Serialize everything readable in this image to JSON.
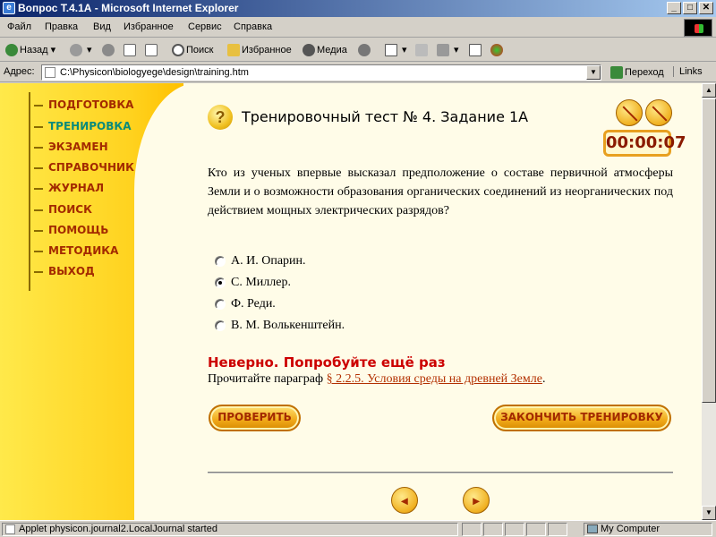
{
  "window": {
    "title": "Вопрос Т.4.1А - Microsoft Internet Explorer",
    "controls": [
      "_",
      "□",
      "✕"
    ]
  },
  "menu": [
    "Файл",
    "Правка",
    "Вид",
    "Избранное",
    "Сервис",
    "Справка"
  ],
  "toolbar": {
    "back": "Назад",
    "search": "Поиск",
    "favorites": "Избранное",
    "media": "Медиа"
  },
  "address": {
    "label": "Адрес:",
    "url": "C:\\Physicon\\biologyege\\design\\training.htm",
    "go": "Переход",
    "links": "Links"
  },
  "sidebar": {
    "items": [
      {
        "label": "ПОДГОТОВКА",
        "active": false
      },
      {
        "label": "ТРЕНИРОВКА",
        "active": true
      },
      {
        "label": "ЭКЗАМЕН",
        "active": false
      },
      {
        "label": "СПРАВОЧНИК",
        "active": false
      },
      {
        "label": "ЖУРНАЛ",
        "active": false
      },
      {
        "label": "ПОИСК",
        "active": false
      },
      {
        "label": "ПОМОЩЬ",
        "active": false
      },
      {
        "label": "МЕТОДИКА",
        "active": false
      },
      {
        "label": "ВЫХОД",
        "active": false
      }
    ]
  },
  "main": {
    "icon": "?",
    "title": "Тренировочный тест № 4. Задание 1А",
    "timer": "00:00:07",
    "question": "Кто из ученых впервые высказал предположение о составе первичной атмосферы Земли и о возможности образования органических соединений из неорганических под действием мощных электрических разрядов?",
    "options": [
      {
        "label": "А. И. Опарин.",
        "selected": false
      },
      {
        "label": "С. Миллер.",
        "selected": true
      },
      {
        "label": "Ф. Реди.",
        "selected": false
      },
      {
        "label": "В. М. Волькенштейн.",
        "selected": false
      }
    ],
    "feedback_error": "Неверно. Попробуйте ещё раз",
    "hint_prefix": "Прочитайте параграф ",
    "hint_link": "§ 2.2.5. Условия среды на древней Земле",
    "hint_suffix": ".",
    "check_button": "ПРОВЕРИТЬ",
    "finish_button": "ЗАКОНЧИТЬ ТРЕНИРОВКУ"
  },
  "status": {
    "text": "Applet physicon.journal2.LocalJournal started",
    "zone": "My Computer"
  }
}
